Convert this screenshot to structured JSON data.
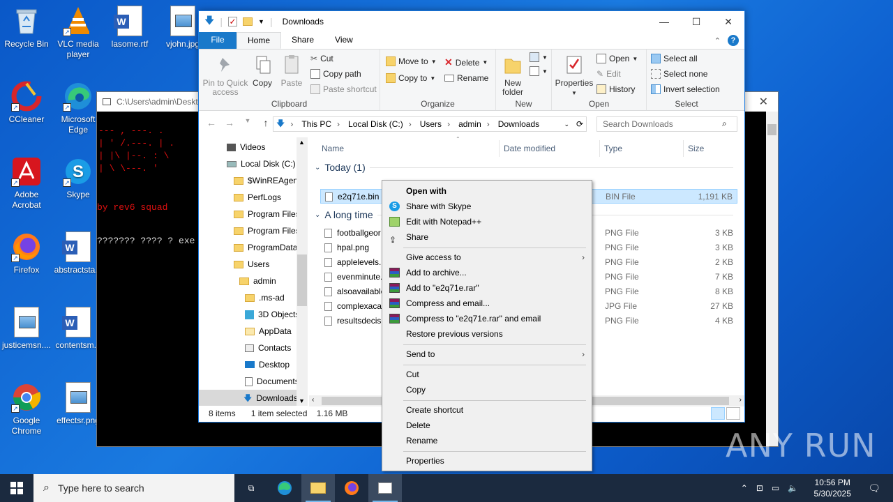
{
  "desktop": {
    "icons": [
      {
        "label": "Recycle Bin"
      },
      {
        "label": "VLC media player"
      },
      {
        "label": "lasome.rtf"
      },
      {
        "label": "vjohn.jpg"
      },
      {
        "label": "CCleaner"
      },
      {
        "label": "Microsoft Edge"
      },
      {
        "label": "Adobe Acrobat"
      },
      {
        "label": "Skype"
      },
      {
        "label": "Firefox"
      },
      {
        "label": "abstractsta..."
      },
      {
        "label": "justicemsn...."
      },
      {
        "label": "contentsm..."
      },
      {
        "label": "Google Chrome"
      },
      {
        "label": "effectsr.png"
      }
    ]
  },
  "console": {
    "title": "C:\\Users\\admin\\Deskt",
    "ascii1": "--- , ---.  .",
    "ascii2": "|  ' /.---. | . ",
    "ascii3": "| |\\  |--. :  \\",
    "ascii4": "|  \\  \\---. '",
    "line_squad": "by rev6 squad",
    "line_exe": "??????? ???? ? exe"
  },
  "explorer": {
    "title": "Downloads",
    "tabs": {
      "file": "File",
      "home": "Home",
      "share": "Share",
      "view": "View"
    },
    "ribbon": {
      "pin": "Pin to Quick access",
      "copy": "Copy",
      "paste": "Paste",
      "cut": "Cut",
      "copy_path": "Copy path",
      "paste_shortcut": "Paste shortcut",
      "clipboard": "Clipboard",
      "move_to": "Move to",
      "copy_to": "Copy to",
      "delete": "Delete",
      "rename": "Rename",
      "organize": "Organize",
      "new_folder": "New folder",
      "new": "New",
      "properties": "Properties",
      "open": "Open",
      "edit": "Edit",
      "history": "History",
      "open_group": "Open",
      "select_all": "Select all",
      "select_none": "Select none",
      "invert_selection": "Invert selection",
      "select": "Select"
    },
    "breadcrumb": [
      "This PC",
      "Local Disk (C:)",
      "Users",
      "admin",
      "Downloads"
    ],
    "search_placeholder": "Search Downloads",
    "nav": [
      "Videos",
      "Local Disk (C:)",
      "$WinREAgent",
      "PerfLogs",
      "Program Files",
      "Program Files",
      "ProgramData",
      "Users",
      "admin",
      ".ms-ad",
      "3D Objects",
      "AppData",
      "Contacts",
      "Desktop",
      "Documents",
      "Downloads"
    ],
    "columns": {
      "name": "Name",
      "date": "Date modified",
      "type": "Type",
      "size": "Size"
    },
    "groups": {
      "today": "Today (1)",
      "long_ago": "A long time"
    },
    "files": [
      {
        "name": "e2q71e.bin",
        "type": "BIN File",
        "size": "1,191 KB"
      },
      {
        "name": "footballgeor",
        "type": "PNG File",
        "size": "3 KB"
      },
      {
        "name": "hpal.png",
        "type": "PNG File",
        "size": "3 KB"
      },
      {
        "name": "applelevels.p",
        "type": "PNG File",
        "size": "2 KB"
      },
      {
        "name": "evenminute.",
        "type": "PNG File",
        "size": "7 KB"
      },
      {
        "name": "alsoavailable",
        "type": "PNG File",
        "size": "8 KB"
      },
      {
        "name": "complexaca",
        "type": "JPG File",
        "size": "27 KB"
      },
      {
        "name": "resultsdecisi",
        "type": "PNG File",
        "size": "4 KB"
      }
    ],
    "status": {
      "count": "8 items",
      "selected": "1 item selected",
      "size": "1.16 MB"
    }
  },
  "context_menu": {
    "open_with": "Open with",
    "share_skype": "Share with Skype",
    "edit_notepad": "Edit with Notepad++",
    "share": "Share",
    "give_access": "Give access to",
    "add_archive": "Add to archive...",
    "add_rar": "Add to \"e2q71e.rar\"",
    "compress_email": "Compress and email...",
    "compress_rar_email": "Compress to \"e2q71e.rar\" and email",
    "restore": "Restore previous versions",
    "send_to": "Send to",
    "cut": "Cut",
    "copy": "Copy",
    "create_shortcut": "Create shortcut",
    "delete": "Delete",
    "rename": "Rename",
    "properties": "Properties"
  },
  "watermark": "ANY RUN",
  "taskbar": {
    "search_placeholder": "Type here to search",
    "time": "10:56 PM",
    "date": "5/30/2025"
  },
  "colors": {
    "accent": "#1979ca",
    "selection": "#cce8ff",
    "console_red": "#e01010"
  }
}
